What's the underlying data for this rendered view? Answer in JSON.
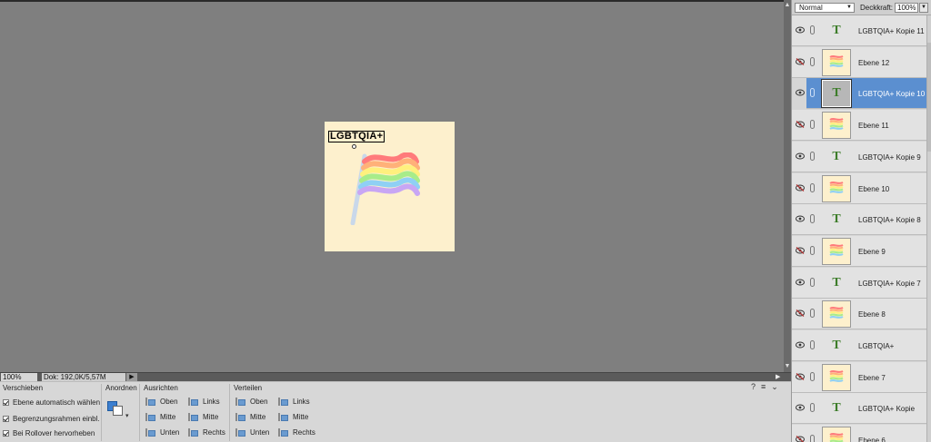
{
  "canvas": {
    "document_text": "LGBTQIA+"
  },
  "status": {
    "zoom": "100%",
    "doc_info": "Dok: 192,0K/5,57M",
    "arrow": "▶"
  },
  "options": {
    "move_title": "Verschieben",
    "auto_select": "Ebene automatisch wählen",
    "show_bounds": "Begrenzungsrahmen einbl.",
    "rollover": "Bei Rollover hervorheben",
    "arrange_title": "Anordnen",
    "align_title": "Ausrichten",
    "distribute_title": "Verteilen",
    "align": {
      "top": "Oben",
      "middle": "Mitte",
      "bottom": "Unten",
      "left": "Links",
      "center": "Mitte",
      "right": "Rechts"
    },
    "distribute": {
      "top": "Oben",
      "middle": "Mitte",
      "bottom": "Unten",
      "left": "Links",
      "center": "Mitte",
      "right": "Rechts"
    },
    "help_icon": "?",
    "menu_icon": "≡",
    "collapse_icon": "⌄"
  },
  "layers_panel": {
    "blend_mode": "Normal",
    "opacity_label": "Deckkraft:",
    "opacity_value": "100%",
    "layers": [
      {
        "name": "LGBTQIA+ Kopie 11",
        "kind": "text",
        "visible": true,
        "selected": false
      },
      {
        "name": "Ebene 12",
        "kind": "image",
        "visible": false,
        "selected": false
      },
      {
        "name": "LGBTQIA+ Kopie 10",
        "kind": "text",
        "visible": true,
        "selected": true
      },
      {
        "name": "Ebene 11",
        "kind": "image",
        "visible": false,
        "selected": false
      },
      {
        "name": "LGBTQIA+ Kopie 9",
        "kind": "text",
        "visible": true,
        "selected": false
      },
      {
        "name": "Ebene 10",
        "kind": "image",
        "visible": false,
        "selected": false
      },
      {
        "name": "LGBTQIA+ Kopie 8",
        "kind": "text",
        "visible": true,
        "selected": false
      },
      {
        "name": "Ebene 9",
        "kind": "image",
        "visible": false,
        "selected": false
      },
      {
        "name": "LGBTQIA+ Kopie 7",
        "kind": "text",
        "visible": true,
        "selected": false
      },
      {
        "name": "Ebene 8",
        "kind": "image",
        "visible": false,
        "selected": false
      },
      {
        "name": "LGBTQIA+",
        "kind": "text",
        "visible": true,
        "selected": false
      },
      {
        "name": "Ebene 7",
        "kind": "image",
        "visible": false,
        "selected": false
      },
      {
        "name": "LGBTQIA+ Kopie",
        "kind": "text",
        "visible": true,
        "selected": false
      },
      {
        "name": "Ebene 6",
        "kind": "image",
        "visible": false,
        "selected": false
      }
    ],
    "text_glyph": "T"
  },
  "colors": {
    "canvas_bg": "#7f7f7f",
    "document_bg": "#fdf0cd",
    "selection": "#5b8fd0",
    "text_layer_icon": "#3d7d2a"
  }
}
